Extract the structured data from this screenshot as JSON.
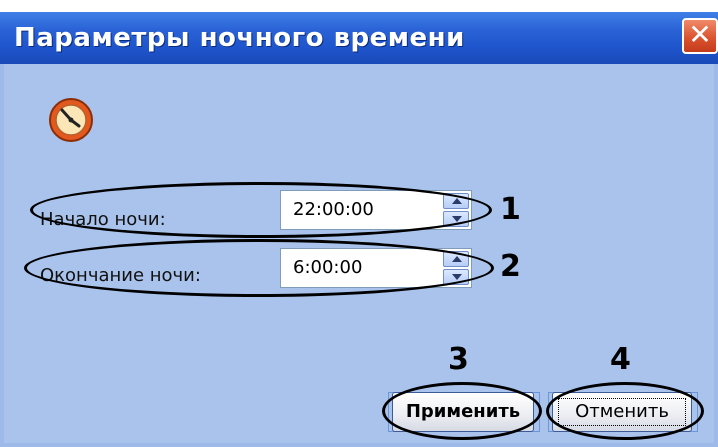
{
  "dialog": {
    "title": "Параметры ночного времени",
    "close_icon": "close-icon",
    "app_icon": "clock-icon"
  },
  "fields": [
    {
      "label": "Начало ночи:",
      "value": "22:00:00",
      "callout": "1"
    },
    {
      "label": "Окончание ночи:",
      "value": "6:00:00",
      "callout": "2"
    }
  ],
  "buttons": {
    "apply": {
      "label": "Применить",
      "callout": "3"
    },
    "cancel": {
      "label": "Отменить",
      "callout": "4"
    }
  },
  "colors": {
    "titlebar": "#1e54cc",
    "dialog_bg": "#a9c3ec",
    "close": "#d9502c"
  }
}
